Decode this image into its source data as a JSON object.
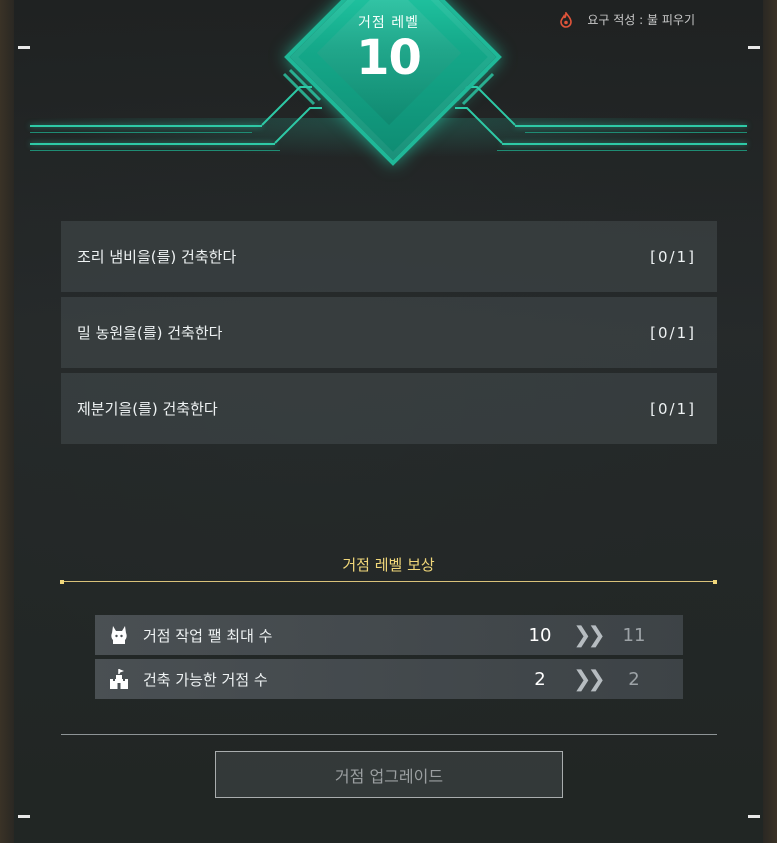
{
  "header": {
    "base_label": "거점 레벨",
    "base_level": "10",
    "requirement": "요구 적성 : 불 피우기"
  },
  "tasks": [
    {
      "label": "조리 냄비을(를) 건축한다",
      "progress": "[0/1]"
    },
    {
      "label": "밀 농원을(를) 건축한다",
      "progress": "[0/1]"
    },
    {
      "label": "제분기을(를) 건축한다",
      "progress": "[0/1]"
    }
  ],
  "rewards": {
    "title": "거점 레벨 보상",
    "items": [
      {
        "icon": "pal-icon",
        "label": "거점 작업 팰 최대 수",
        "current": "10",
        "next": "11"
      },
      {
        "icon": "castle-icon",
        "label": "건축 가능한 거점 수",
        "current": "2",
        "next": "2"
      }
    ]
  },
  "upgrade_button": "거점 업그레이드",
  "colors": {
    "accent": "#2ec9a6",
    "reward_gold": "#f1d77a",
    "flame": "#e0543a"
  }
}
